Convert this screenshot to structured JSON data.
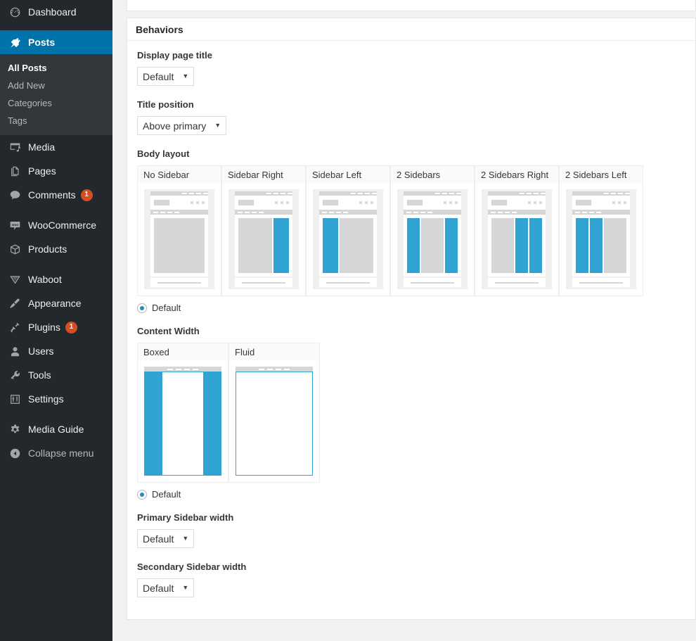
{
  "sidebar": {
    "items": [
      {
        "label": "Dashboard",
        "icon": "dashboard-icon",
        "current": false
      },
      {
        "label": "Posts",
        "icon": "pin-icon",
        "current": true
      },
      {
        "label": "Media",
        "icon": "media-icon",
        "current": false
      },
      {
        "label": "Pages",
        "icon": "pages-icon",
        "current": false
      },
      {
        "label": "Comments",
        "icon": "comment-icon",
        "current": false,
        "bubble": "1"
      },
      {
        "label": "WooCommerce",
        "icon": "woocommerce-icon",
        "current": false
      },
      {
        "label": "Products",
        "icon": "products-box-icon",
        "current": false
      },
      {
        "label": "Waboot",
        "icon": "waboot-icon",
        "current": false
      },
      {
        "label": "Appearance",
        "icon": "paintbrush-icon",
        "current": false
      },
      {
        "label": "Plugins",
        "icon": "plug-icon",
        "current": false,
        "bubble": "1"
      },
      {
        "label": "Users",
        "icon": "user-icon",
        "current": false
      },
      {
        "label": "Tools",
        "icon": "wrench-icon",
        "current": false
      },
      {
        "label": "Settings",
        "icon": "settings-sliders-icon",
        "current": false
      },
      {
        "label": "Media Guide",
        "icon": "gear-icon",
        "current": false
      }
    ],
    "submenu": [
      {
        "label": "All Posts",
        "current": true
      },
      {
        "label": "Add New",
        "current": false
      },
      {
        "label": "Categories",
        "current": false
      },
      {
        "label": "Tags",
        "current": false
      }
    ],
    "collapse": {
      "label": "Collapse menu",
      "icon": "collapse-arrow-icon"
    }
  },
  "panel": {
    "title": "Behaviors",
    "display_page_title": {
      "label": "Display page title",
      "value": "Default",
      "caret": "▼"
    },
    "title_position": {
      "label": "Title position",
      "value": "Above primary",
      "caret": "▼"
    },
    "body_layout": {
      "label": "Body layout",
      "options": [
        {
          "label": "No Sidebar",
          "name": "layout-no-sidebar",
          "columns": [
            "content"
          ]
        },
        {
          "label": "Sidebar Right",
          "name": "layout-sidebar-right",
          "columns": [
            "content",
            "side"
          ]
        },
        {
          "label": "Sidebar Left",
          "name": "layout-sidebar-left",
          "columns": [
            "side",
            "content"
          ]
        },
        {
          "label": "2 Sidebars",
          "name": "layout-2-sidebars",
          "columns": [
            "side",
            "content",
            "side"
          ]
        },
        {
          "label": "2 Sidebars Right",
          "name": "layout-2-sidebars-right",
          "columns": [
            "content",
            "side",
            "side"
          ]
        },
        {
          "label": "2 Sidebars Left",
          "name": "layout-2-sidebars-left",
          "columns": [
            "side",
            "side",
            "content"
          ]
        }
      ],
      "default_radio": "Default"
    },
    "content_width": {
      "label": "Content Width",
      "options": [
        {
          "label": "Boxed",
          "name": "content-width-boxed",
          "boxed": true
        },
        {
          "label": "Fluid",
          "name": "content-width-fluid",
          "boxed": false
        }
      ],
      "default_radio": "Default"
    },
    "primary_sidebar_width": {
      "label": "Primary Sidebar width",
      "value": "Default",
      "caret": "▼"
    },
    "secondary_sidebar_width": {
      "label": "Secondary Sidebar width",
      "value": "Default",
      "caret": "▼"
    }
  },
  "colors": {
    "admin_bg": "#23282d",
    "submenu_bg": "#32373c",
    "current_blue": "#0073aa",
    "accent_blue": "#31a3d3",
    "radio_blue": "#1e8cbe",
    "bubble_red": "#d54e21",
    "page_bg": "#f1f1f1",
    "thumb_gray": "#d6d6d6"
  }
}
